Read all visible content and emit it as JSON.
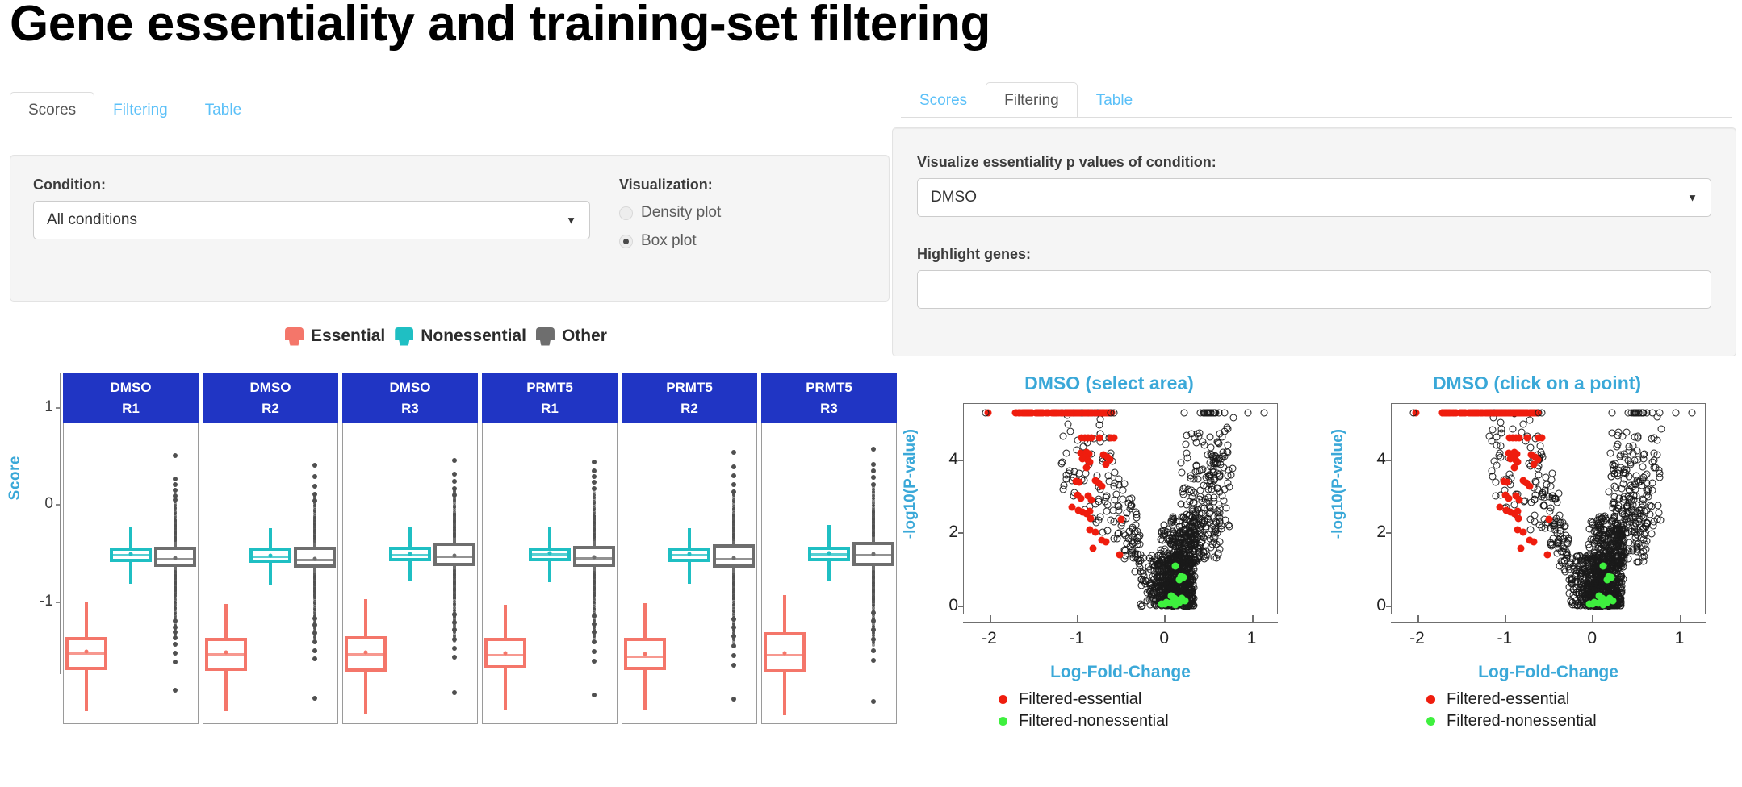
{
  "title": "Gene essentiality and training-set filtering",
  "left_panel": {
    "tabs": [
      {
        "label": "Scores",
        "active": true
      },
      {
        "label": "Filtering",
        "active": false
      },
      {
        "label": "Table",
        "active": false
      }
    ],
    "condition_label": "Condition:",
    "condition_value": "All conditions",
    "visualization_label": "Visualization:",
    "radios": [
      {
        "label": "Density plot",
        "checked": false
      },
      {
        "label": "Box plot",
        "checked": true
      }
    ]
  },
  "right_panel": {
    "tabs": [
      {
        "label": "Scores",
        "active": false
      },
      {
        "label": "Filtering",
        "active": true
      },
      {
        "label": "Table",
        "active": false
      }
    ],
    "condition_label": "Visualize essentiality p values of condition:",
    "condition_value": "DMSO",
    "highlight_label": "Highlight genes:",
    "highlight_value": "",
    "highlight_placeholder": ""
  },
  "colors": {
    "essential": "#f4766a",
    "nonessential": "#1fbfc3",
    "other": "#6e6e6e",
    "facet_header": "#2035c4",
    "axis_label": "#3aa8d8",
    "tab_link": "#5bc0f8",
    "filtered_essential": "#ef1d0e",
    "filtered_nonessential": "#3ef03e"
  },
  "chart_data": [
    {
      "type": "box",
      "title": "",
      "xlabel": "",
      "ylabel": "Score",
      "ylim": [
        -1.75,
        1.35
      ],
      "yticks": [
        1,
        0,
        -1
      ],
      "ytick_labels": [
        "1",
        "0",
        "-1"
      ],
      "grid": false,
      "legend_position": "top-center",
      "legend": [
        {
          "name": "Essential",
          "color": "#f4766a"
        },
        {
          "name": "Nonessential",
          "color": "#1fbfc3"
        },
        {
          "name": "Other",
          "color": "#6e6e6e"
        }
      ],
      "facets": [
        {
          "condition": "DMSO",
          "replicate": "R1",
          "boxes": [
            {
              "group": "Essential",
              "lower_whisker": -1.62,
              "q1": -1.19,
              "median": -1.01,
              "mean": -1.0,
              "q3": -0.85,
              "upper_whisker": -0.49
            },
            {
              "group": "Nonessential",
              "lower_whisker": -0.3,
              "q1": -0.08,
              "median": 0.0,
              "mean": 0.0,
              "q3": 0.07,
              "upper_whisker": 0.28
            },
            {
              "group": "Other",
              "lower_whisker": -0.41,
              "q1": -0.13,
              "median": -0.04,
              "mean": -0.04,
              "q3": 0.08,
              "upper_whisker": 0.35,
              "outliers": [
                1.02,
                0.78,
                0.72,
                0.66,
                0.6,
                0.56,
                -0.69,
                -0.75,
                -0.8,
                -0.86,
                -0.93,
                -1.02,
                -1.11,
                -1.4
              ]
            }
          ]
        },
        {
          "condition": "DMSO",
          "replicate": "R2",
          "boxes": [
            {
              "group": "Essential",
              "lower_whisker": -1.62,
              "q1": -1.2,
              "median": -1.02,
              "mean": -1.01,
              "q3": -0.86,
              "upper_whisker": -0.51
            },
            {
              "group": "Nonessential",
              "lower_whisker": -0.31,
              "q1": -0.09,
              "median": -0.01,
              "mean": -0.01,
              "q3": 0.07,
              "upper_whisker": 0.27
            },
            {
              "group": "Other",
              "lower_whisker": -0.44,
              "q1": -0.14,
              "median": -0.05,
              "mean": -0.05,
              "q3": 0.08,
              "upper_whisker": 0.38,
              "outliers": [
                0.92,
                0.8,
                0.7,
                0.62,
                0.55,
                -0.66,
                -0.73,
                -0.81,
                -0.9,
                -0.99,
                -1.08,
                -1.48
              ]
            }
          ]
        },
        {
          "condition": "DMSO",
          "replicate": "R3",
          "boxes": [
            {
              "group": "Essential",
              "lower_whisker": -1.64,
              "q1": -1.21,
              "median": -1.02,
              "mean": -1.01,
              "q3": -0.84,
              "upper_whisker": -0.46
            },
            {
              "group": "Nonessential",
              "lower_whisker": -0.28,
              "q1": -0.07,
              "median": 0.0,
              "mean": 0.0,
              "q3": 0.08,
              "upper_whisker": 0.29
            },
            {
              "group": "Other",
              "lower_whisker": -0.46,
              "q1": -0.12,
              "median": -0.01,
              "mean": -0.01,
              "q3": 0.12,
              "upper_whisker": 0.43,
              "outliers": [
                0.97,
                0.83,
                0.75,
                0.68,
                0.61,
                -0.62,
                -0.7,
                -0.78,
                -0.88,
                -0.97,
                -1.06,
                -1.43
              ]
            }
          ]
        },
        {
          "condition": "PRMT5",
          "replicate": "R1",
          "boxes": [
            {
              "group": "Essential",
              "lower_whisker": -1.6,
              "q1": -1.18,
              "median": -1.03,
              "mean": -1.02,
              "q3": -0.86,
              "upper_whisker": -0.52
            },
            {
              "group": "Nonessential",
              "lower_whisker": -0.29,
              "q1": -0.07,
              "median": 0.01,
              "mean": 0.01,
              "q3": 0.07,
              "upper_whisker": 0.28
            },
            {
              "group": "Other",
              "lower_whisker": -0.43,
              "q1": -0.13,
              "median": -0.03,
              "mean": -0.03,
              "q3": 0.09,
              "upper_whisker": 0.4,
              "outliers": [
                0.95,
                0.86,
                0.8,
                0.74,
                0.68,
                -0.64,
                -0.72,
                -0.8,
                -0.9,
                -1.0,
                -1.1,
                -1.45
              ]
            }
          ]
        },
        {
          "condition": "PRMT5",
          "replicate": "R2",
          "boxes": [
            {
              "group": "Essential",
              "lower_whisker": -1.61,
              "q1": -1.19,
              "median": -1.04,
              "mean": -1.03,
              "q3": -0.86,
              "upper_whisker": -0.5
            },
            {
              "group": "Nonessential",
              "lower_whisker": -0.3,
              "q1": -0.08,
              "median": 0.0,
              "mean": 0.0,
              "q3": 0.07,
              "upper_whisker": 0.27
            },
            {
              "group": "Other",
              "lower_whisker": -0.47,
              "q1": -0.14,
              "median": -0.04,
              "mean": -0.04,
              "q3": 0.1,
              "upper_whisker": 0.42,
              "outliers": [
                1.05,
                0.9,
                0.81,
                0.72,
                0.64,
                -0.67,
                -0.75,
                -0.84,
                -0.94,
                -1.04,
                -1.14,
                -1.49
              ]
            }
          ]
        },
        {
          "condition": "PRMT5",
          "replicate": "R3",
          "boxes": [
            {
              "group": "Essential",
              "lower_whisker": -1.66,
              "q1": -1.22,
              "median": -1.03,
              "mean": -1.02,
              "q3": -0.8,
              "upper_whisker": -0.42
            },
            {
              "group": "Nonessential",
              "lower_whisker": -0.27,
              "q1": -0.07,
              "median": 0.01,
              "mean": 0.01,
              "q3": 0.08,
              "upper_whisker": 0.3
            },
            {
              "group": "Other",
              "lower_whisker": -0.5,
              "q1": -0.12,
              "median": 0.0,
              "mean": 0.0,
              "q3": 0.13,
              "upper_whisker": 0.46,
              "outliers": [
                1.08,
                0.93,
                0.86,
                0.79,
                0.72,
                -0.6,
                -0.69,
                -0.78,
                -0.88,
                -0.99,
                -1.09,
                -1.52
              ]
            }
          ]
        }
      ]
    },
    {
      "type": "scatter",
      "id": "volcano-select-area",
      "title": "DMSO (select area)",
      "xlabel": "Log-Fold-Change",
      "ylabel": "-log10(P-value)",
      "xlim": [
        -2.3,
        1.3
      ],
      "ylim": [
        -0.25,
        5.55
      ],
      "xticks": [
        -2,
        -1,
        0,
        1
      ],
      "xtick_labels": [
        "-2",
        "-1",
        "0",
        "1"
      ],
      "yticks": [
        0,
        2,
        4
      ],
      "ytick_labels": [
        "0",
        "2",
        "4"
      ],
      "grid": false,
      "legend_position": "below-axis",
      "legend": [
        {
          "name": "Filtered-essential",
          "color": "#ef1d0e"
        },
        {
          "name": "Filtered-nonessential",
          "color": "#3ef03e"
        }
      ]
    },
    {
      "type": "scatter",
      "id": "volcano-click-point",
      "title": "DMSO (click on a point)",
      "xlabel": "Log-Fold-Change",
      "ylabel": "-log10(P-value)",
      "xlim": [
        -2.3,
        1.3
      ],
      "ylim": [
        -0.25,
        5.55
      ],
      "xticks": [
        -2,
        -1,
        0,
        1
      ],
      "xtick_labels": [
        "-2",
        "-1",
        "0",
        "1"
      ],
      "yticks": [
        0,
        2,
        4
      ],
      "ytick_labels": [
        "0",
        "2",
        "4"
      ],
      "grid": false,
      "legend_position": "below-axis",
      "legend": [
        {
          "name": "Filtered-essential",
          "color": "#ef1d0e"
        },
        {
          "name": "Filtered-nonessential",
          "color": "#3ef03e"
        }
      ]
    }
  ]
}
